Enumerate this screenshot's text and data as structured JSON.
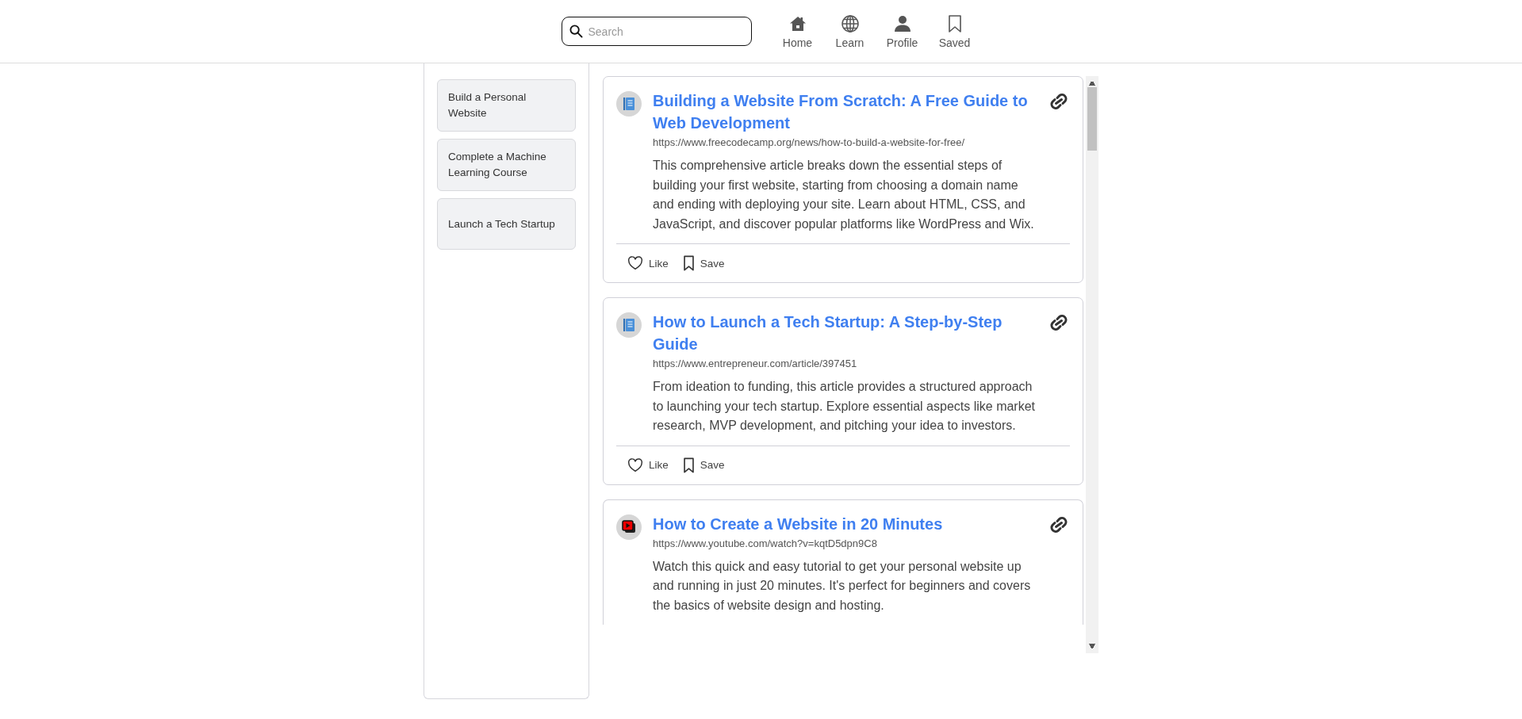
{
  "search": {
    "placeholder": "Search"
  },
  "nav": [
    {
      "label": "Home",
      "kind": "home"
    },
    {
      "label": "Learn",
      "kind": "learn"
    },
    {
      "label": "Profile",
      "kind": "profile"
    },
    {
      "label": "Saved",
      "kind": "saved"
    }
  ],
  "sidebar": {
    "items": [
      {
        "label": "Build a Personal Website"
      },
      {
        "label": "Complete a Machine Learning Course"
      },
      {
        "label": "Launch a Tech Startup"
      }
    ]
  },
  "resources": [
    {
      "kind": "article",
      "title": "Building a Website From Scratch: A Free Guide to Web Development",
      "url": "https://www.freecodecamp.org/news/how-to-build-a-website-for-free/",
      "description": "This comprehensive article breaks down the essential steps of building your first website, starting from choosing a domain name and ending with deploying your site. Learn about HTML, CSS, and JavaScript, and discover popular platforms like WordPress and Wix.",
      "actions": [
        "Like",
        "Save"
      ]
    },
    {
      "kind": "article",
      "title": "How to Launch a Tech Startup: A Step-by-Step Guide",
      "url": "https://www.entrepreneur.com/article/397451",
      "description": "From ideation to funding, this article provides a structured approach to launching your tech startup. Explore essential aspects like market research, MVP development, and pitching your idea to investors.",
      "actions": [
        "Like",
        "Save"
      ]
    },
    {
      "kind": "video",
      "title": "How to Create a Website in 20 Minutes",
      "url": "https://www.youtube.com/watch?v=kqtD5dpn9C8",
      "description": "Watch this quick and easy tutorial to get your personal website up and running in just 20 minutes. It's perfect for beginners and covers the basics of website design and hosting."
    }
  ]
}
